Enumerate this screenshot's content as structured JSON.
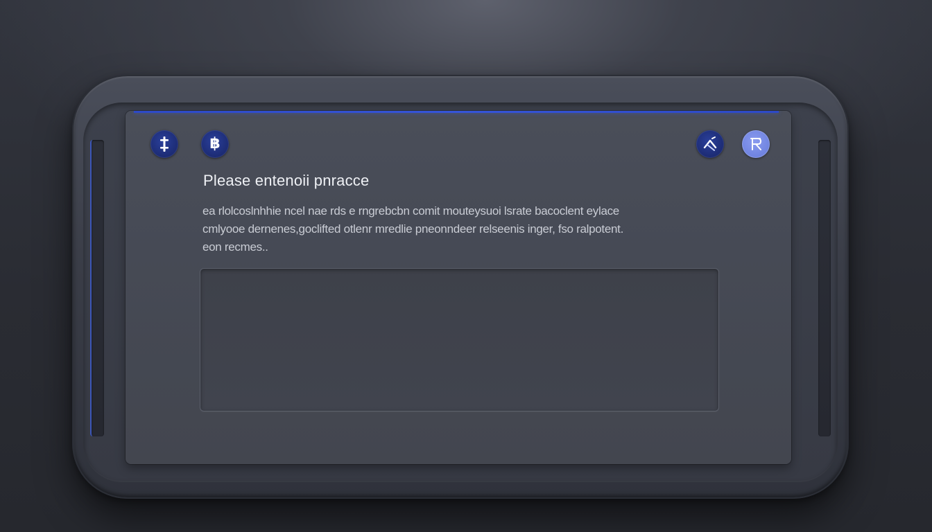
{
  "dialog": {
    "title": "Please entenoii pnracce",
    "description_lines": [
      "ea rlolcoslnhhie ncel nae rds e rngrebcbn comit mouteysuoi lsrate bacoclent eylace",
      "cmlyooe dernenes,goclifted otlenr mredlie pneonndeer relseenis inger, fso ralpotent.",
      "eon recmes.."
    ],
    "passphrase_field": {
      "value": "",
      "placeholder": ""
    }
  },
  "icons": {
    "left": [
      {
        "name": "ticker-icon",
        "glyph": "Ɨ"
      },
      {
        "name": "bitcoin-icon",
        "glyph": "฿"
      }
    ],
    "right": [
      {
        "name": "swap-icon",
        "glyph": "✕"
      },
      {
        "name": "reset-icon",
        "glyph": "R"
      }
    ]
  },
  "colors": {
    "accent": "#3554d9",
    "icon_dark": "#1c2b73",
    "icon_light": "#6f83e0",
    "panel": "#464a55",
    "background": "#2a2c33"
  }
}
